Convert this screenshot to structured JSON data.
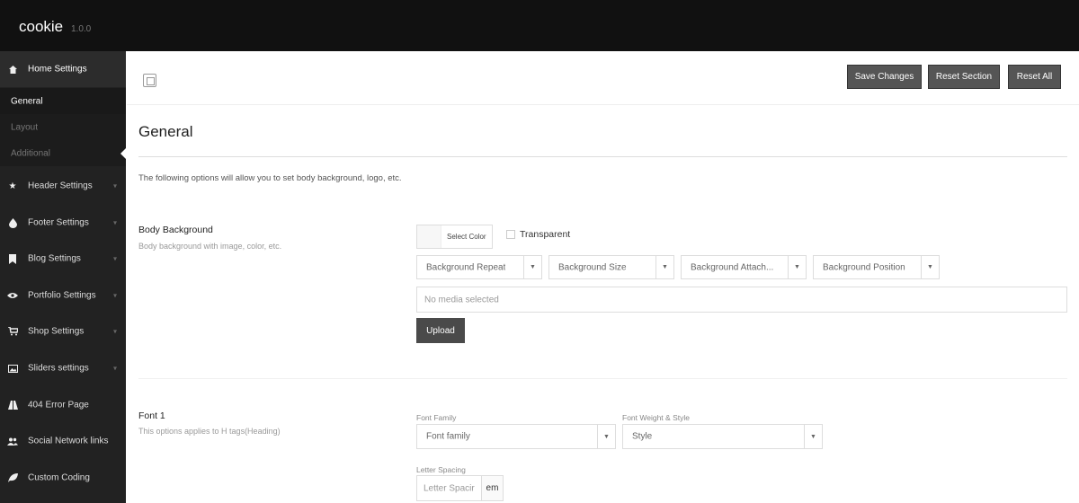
{
  "app": {
    "title": "cookie",
    "version": "1.0.0"
  },
  "sidebar": {
    "items": [
      {
        "label": "Home Settings",
        "icon": "home-icon",
        "glyph": "⌂",
        "chevron": false
      },
      {
        "label": "Header Settings",
        "icon": "star-icon",
        "glyph": "★",
        "chevron": true
      },
      {
        "label": "Footer Settings",
        "icon": "drop-icon",
        "glyph": "💧",
        "chevron": true
      },
      {
        "label": "Blog Settings",
        "icon": "bookmark-icon",
        "glyph": "▮",
        "chevron": true
      },
      {
        "label": "Portfolio Settings",
        "icon": "eye-icon",
        "glyph": "◉",
        "chevron": true
      },
      {
        "label": "Shop Settings",
        "icon": "cart-icon",
        "glyph": "🛒",
        "chevron": true
      },
      {
        "label": "Sliders settings",
        "icon": "image-icon",
        "glyph": "▣",
        "chevron": true
      },
      {
        "label": "404 Error Page",
        "icon": "road-icon",
        "glyph": "⛛",
        "chevron": false
      },
      {
        "label": "Social Network links",
        "icon": "users-icon",
        "glyph": "👥",
        "chevron": false
      },
      {
        "label": "Custom Coding",
        "icon": "leaf-icon",
        "glyph": "❦",
        "chevron": false
      }
    ],
    "subitems": [
      "General",
      "Layout",
      "Additional"
    ]
  },
  "toolbar": {
    "save": "Save Changes",
    "reset_section": "Reset Section",
    "reset_all": "Reset All"
  },
  "page": {
    "title": "General",
    "description": "The following options will allow you to set body background, logo, etc."
  },
  "body_background": {
    "title": "Body Background",
    "subtitle": "Body background with image, color, etc.",
    "select_color": "Select Color",
    "transparent": "Transparent",
    "selects": [
      "Background Repeat",
      "Background Size",
      "Background Attach...",
      "Background Position"
    ],
    "media_placeholder": "No media selected",
    "upload": "Upload"
  },
  "font1": {
    "title": "Font 1",
    "subtitle": "This options applies to H tags(Heading)",
    "family_label": "Font Family",
    "family_value": "Font family",
    "weight_label": "Font Weight & Style",
    "weight_value": "Style",
    "spacing_label": "Letter Spacing",
    "spacing_placeholder": "Letter Spacir",
    "spacing_unit": "em"
  },
  "colors": {
    "topbar": "#111111",
    "sidebar": "#222222",
    "button": "#555555"
  }
}
